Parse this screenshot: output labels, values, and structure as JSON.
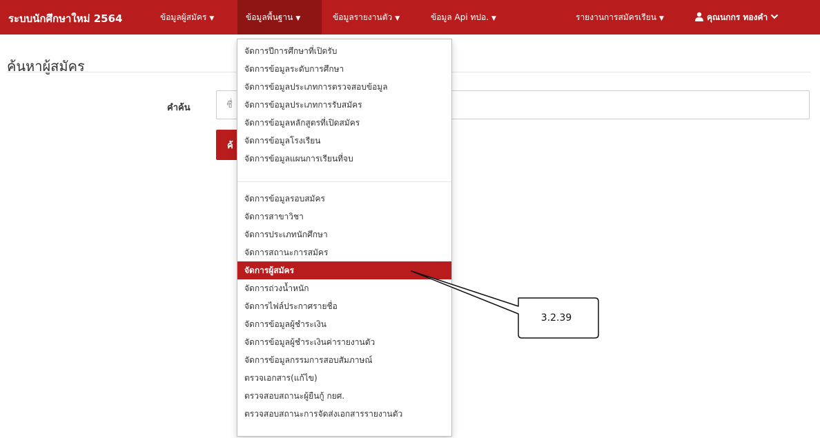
{
  "navbar": {
    "brand": "ระบบนักศึกษาใหม่ 2564",
    "items": [
      {
        "label": "ข้อมูลผู้สมัคร"
      },
      {
        "label": "ข้อมูลพื้นฐาน"
      },
      {
        "label": "ข้อมูลรายงานตัว"
      },
      {
        "label": "ข้อมูล Api ทปอ."
      },
      {
        "label": "รายงานการสมัครเรียน"
      }
    ],
    "user": {
      "name": "คุณนกกร ทองคำ"
    },
    "colors": {
      "background": "#b91c1c",
      "active": "#8f1414"
    }
  },
  "page": {
    "title": "ค้นหาผู้สมัคร",
    "search": {
      "label": "คำค้น",
      "placeholder": "ชื่",
      "button_label": "ค้"
    }
  },
  "dropdown": {
    "group1": [
      "จัดการปีการศึกษาที่เปิดรับ",
      "จัดการข้อมูลระดับการศึกษา",
      "จัดการข้อมูลประเภทการตรวจสอบข้อมูล",
      "จัดการข้อมูลประเภทการรับสมัคร",
      "จัดการข้อมูลหลักสูตรที่เปิดสมัคร",
      "จัดการข้อมูลโรงเรียน",
      "จัดการข้อมูลแผนการเรียนที่จบ"
    ],
    "group2": [
      "จัดการข้อมูลรอบสมัคร",
      "จัดการสาขาวิชา",
      "จัดการประเภทนักศึกษา",
      "จัดการสถานะการสมัคร",
      "จัดการผู้สมัคร",
      "จัดการถ่วงน้ำหนัก",
      "จัดการไฟล์ประกาศรายชื่อ",
      "จัดการข้อมูลผู้ชำระเงิน",
      "จัดการข้อมูลผู้ชำระเงินค่ารายงานตัว",
      "จัดการข้อมูลกรรมการสอบสัมภาษณ์",
      "ตรวจเอกสาร(แก้ไข)",
      "ตรวจสอบสถานะผู้ยืนกู้ กยศ.",
      "ตรวจสอบสถานะการจัดส่งเอกสารรายงานตัว"
    ],
    "highlighted": "จัดการผู้สมัคร"
  },
  "callout": {
    "label": "3.2.39"
  }
}
